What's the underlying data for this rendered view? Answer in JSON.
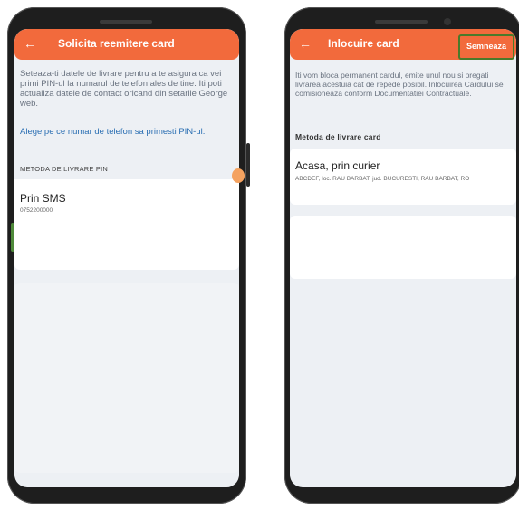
{
  "left_screen": {
    "title": "Solicita reemitere card",
    "back_icon": "arrow-left",
    "description": "Seteaza-ti datele de livrare pentru a te asigura ca vei primi PIN-ul la numarul  de telefon ales de tine. Iti poti actualiza datele de contact oricand din setarile George web.",
    "link_text": "Alege pe ce numar de telefon sa primesti PIN-ul.",
    "section_label": "METODA DE LIVRARE PIN",
    "option": {
      "title": "Prin SMS",
      "subtitle": "0752200000"
    }
  },
  "right_screen": {
    "title": "Inlocuire card",
    "back_icon": "arrow-left",
    "sign_button": "Semneaza",
    "description": "Iti vom bloca permanent cardul, emite unul nou si pregati livrarea acestuia cat de repede posibil. Inlocuirea Cardului se comisioneaza conform Documentatiei Contractuale.",
    "section_label": "Metoda de livrare card",
    "option": {
      "title": "Acasa, prin curier",
      "subtitle": "ABCDEF, loc. RAU BARBAT, jud. BUCURESTI, RAU BARBAT, RO"
    }
  },
  "colors": {
    "header_orange": "#f26a3c",
    "link_blue": "#2b6fb3",
    "highlight_green": "#4a7a2a"
  }
}
